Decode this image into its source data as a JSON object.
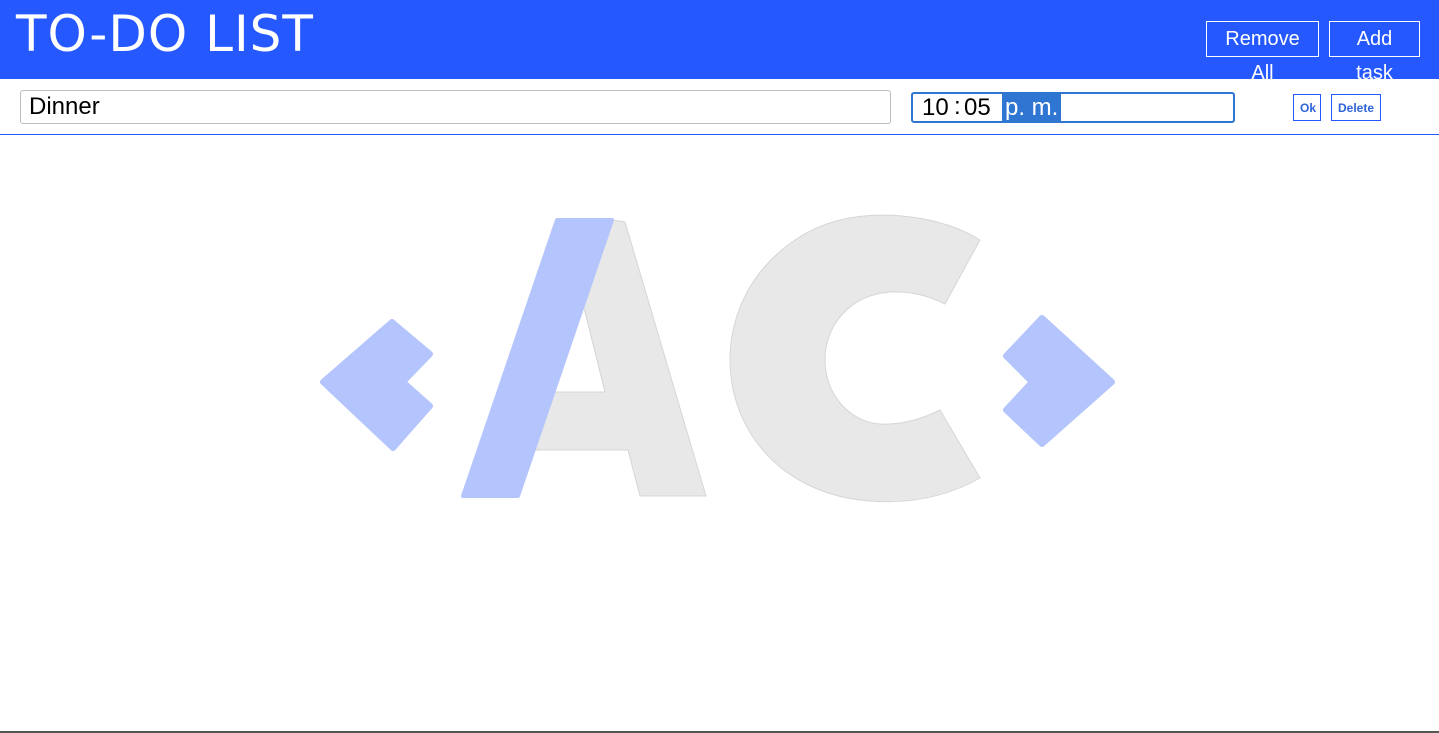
{
  "header": {
    "title": "TO-DO LIST",
    "remove_all_label": "Remove All",
    "add_task_label": "Add task"
  },
  "task": {
    "name": "Dinner",
    "time_hours": "10",
    "time_separator": ":",
    "time_minutes": "05",
    "time_ampm": "p. m.",
    "ok_label": "Ok",
    "delete_label": "Delete"
  },
  "colors": {
    "header_bg": "#2558ff",
    "accent_blue": "#2f76d2",
    "logo_blue": "#b4c4fc",
    "logo_gray": "#e8e8e8"
  },
  "logo": {
    "name": "ac-logo-watermark"
  }
}
